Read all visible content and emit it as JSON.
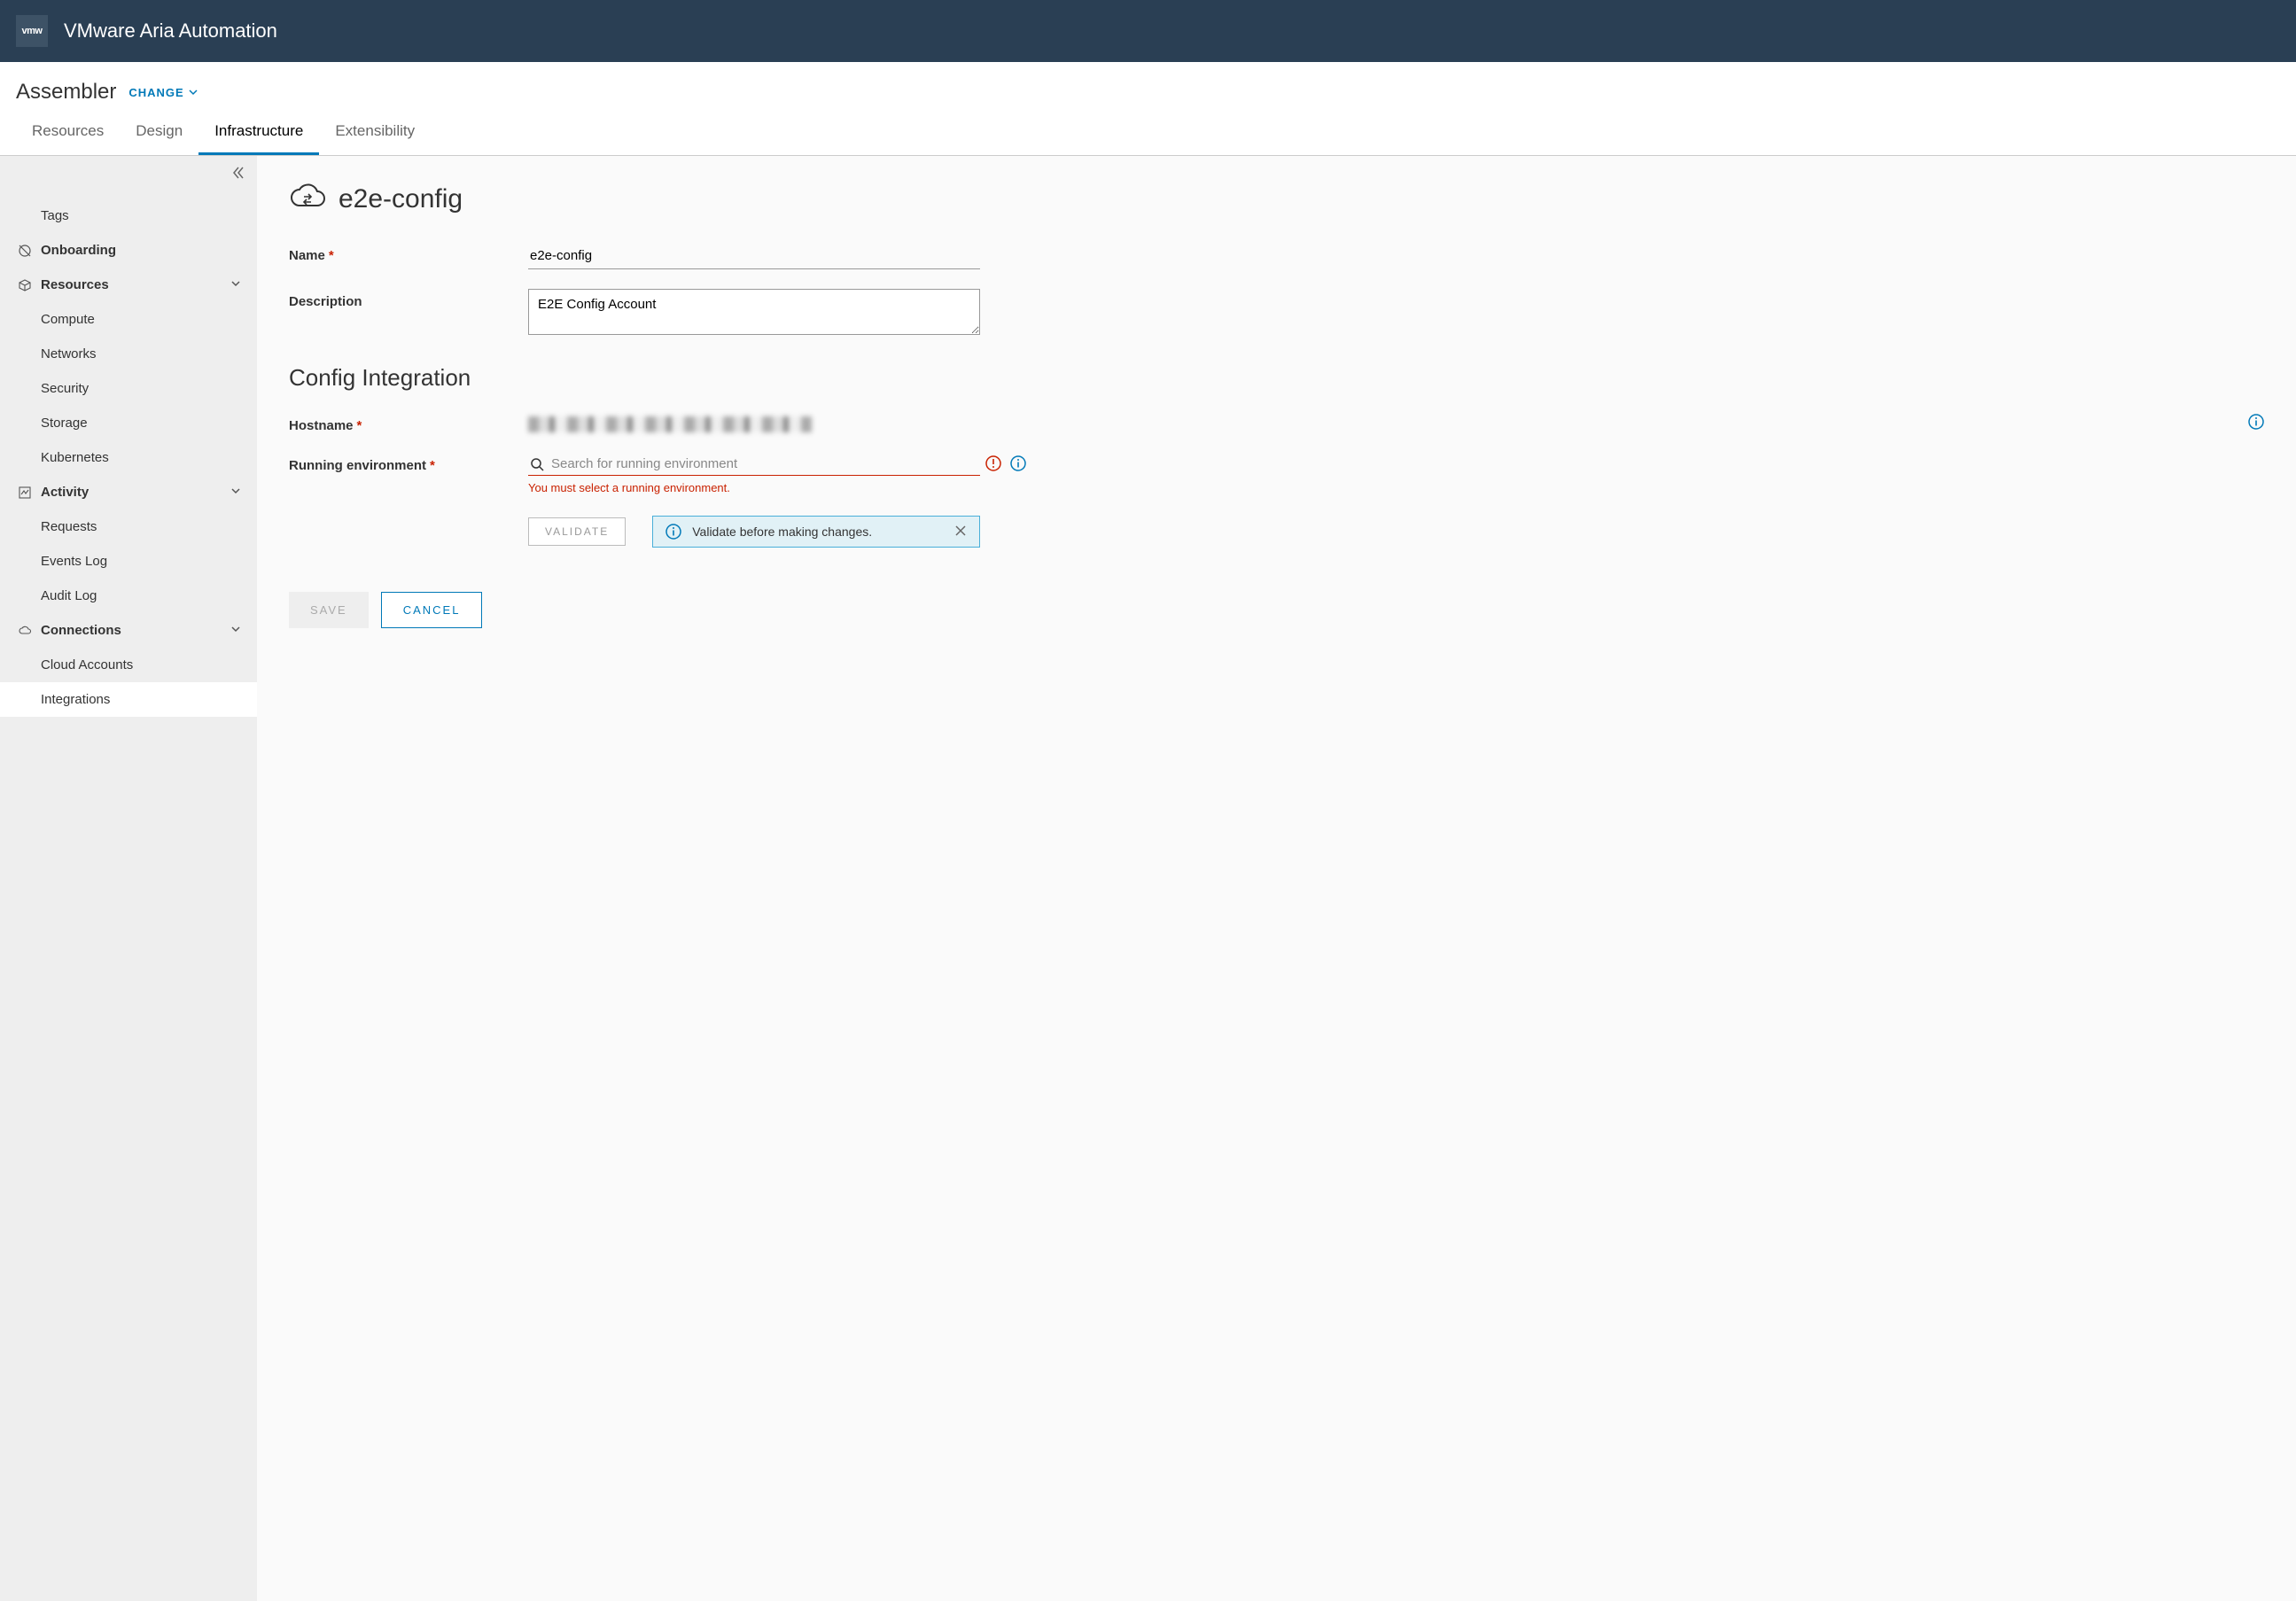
{
  "topbar": {
    "logo_text": "vmw",
    "title": "VMware Aria Automation"
  },
  "subheader": {
    "service": "Assembler",
    "change_label": "CHANGE"
  },
  "tabs": [
    {
      "label": "Resources"
    },
    {
      "label": "Design"
    },
    {
      "label": "Infrastructure"
    },
    {
      "label": "Extensibility"
    }
  ],
  "sidebar": {
    "tags_label": "Tags",
    "onboarding_label": "Onboarding",
    "resources_label": "Resources",
    "resources_items": {
      "compute": "Compute",
      "networks": "Networks",
      "security": "Security",
      "storage": "Storage",
      "kubernetes": "Kubernetes"
    },
    "activity_label": "Activity",
    "activity_items": {
      "requests": "Requests",
      "events_log": "Events Log",
      "audit_log": "Audit Log"
    },
    "connections_label": "Connections",
    "connections_items": {
      "cloud_accounts": "Cloud Accounts",
      "integrations": "Integrations"
    }
  },
  "page": {
    "heading": "e2e-config",
    "name_label": "Name",
    "name_value": "e2e-config",
    "description_label": "Description",
    "description_value": "E2E Config Account",
    "section_heading": "Config Integration",
    "hostname_label": "Hostname",
    "running_env_label": "Running environment",
    "running_env_placeholder": "Search for running environment",
    "running_env_error": "You must select a running environment.",
    "validate_label": "VALIDATE",
    "banner_text": "Validate before making changes.",
    "save_label": "SAVE",
    "cancel_label": "CANCEL"
  }
}
